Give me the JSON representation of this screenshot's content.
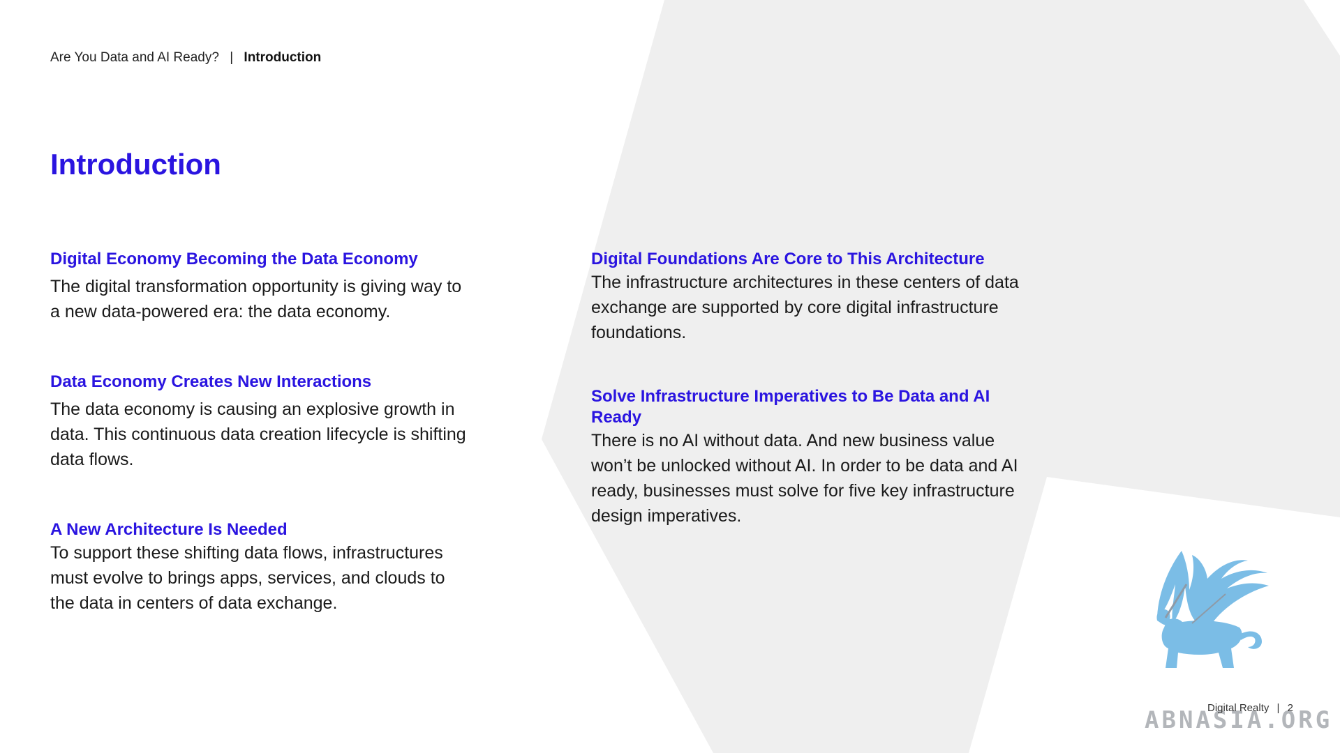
{
  "header": {
    "breadcrumb_parent": "Are You Data and AI Ready?",
    "breadcrumb_separator": "|",
    "breadcrumb_current": "Introduction"
  },
  "page_title": "Introduction",
  "sections": [
    {
      "heading": "Digital Economy Becoming the Data Economy",
      "body": "The digital transformation opportunity is giving way to a new data-powered era: the data economy."
    },
    {
      "heading": "Data Economy Creates New Interactions",
      "body": "The data economy is causing an explosive growth in data. This continuous data creation lifecycle is shifting data flows."
    },
    {
      "heading": "A New Architecture Is Needed",
      "body": "To support these shifting data flows, infrastructures must evolve to brings apps, services, and clouds to the data in centers of data exchange."
    },
    {
      "heading": "Digital Foundations Are Core to This Architecture",
      "body": "The infrastructure architectures in these centers of data exchange are supported by core digital infrastructure foundations."
    },
    {
      "heading": "Solve Infrastructure Imperatives to Be Data and AI Ready",
      "body": "There is no AI without data. And new business value won’t be unlocked without AI. In order to be data and AI ready, businesses must solve for five key infrastructure design imperatives."
    }
  ],
  "footer": {
    "brand": "Digital Realty",
    "separator": "|",
    "page_number": "2"
  },
  "watermark": {
    "text": "ABNASIA.ORG"
  },
  "colors": {
    "accent": "#2a14e0",
    "background_shape": "#efefef",
    "logo_blue": "#7bbde6"
  }
}
